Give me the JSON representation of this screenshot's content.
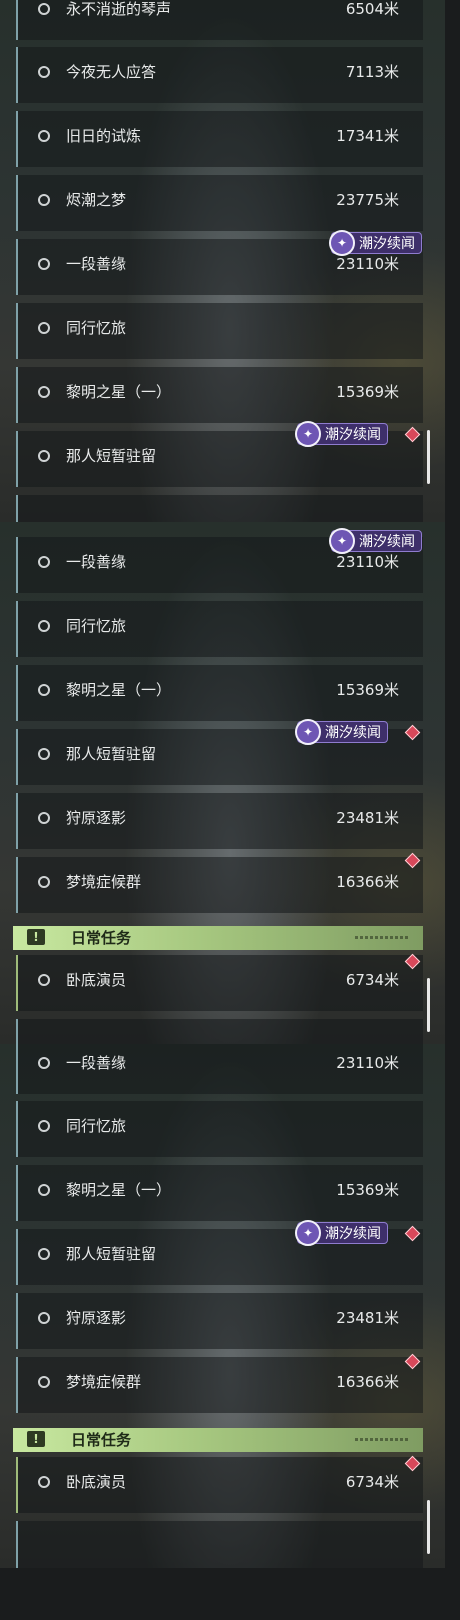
{
  "quests_top": [
    {
      "name": "永不消逝的琴声",
      "dist": "6504米"
    },
    {
      "name": "今夜无人应答",
      "dist": "7113米"
    },
    {
      "name": "旧日的试炼",
      "dist": "17341米"
    },
    {
      "name": "烬潮之梦",
      "dist": "23775米"
    },
    {
      "name": "一段善缘",
      "dist": "23110米"
    },
    {
      "name": "同行忆旅",
      "dist": ""
    },
    {
      "name": "黎明之星（一）",
      "dist": "15369米"
    },
    {
      "name": "那人短暂驻留",
      "dist": ""
    }
  ],
  "quests_mid": [
    {
      "name": "一段善缘",
      "dist": "23110米"
    },
    {
      "name": "同行忆旅",
      "dist": ""
    },
    {
      "name": "黎明之星（一）",
      "dist": "15369米"
    },
    {
      "name": "那人短暂驻留",
      "dist": ""
    },
    {
      "name": "狩原逐影",
      "dist": "23481米"
    },
    {
      "name": "梦境症候群",
      "dist": "16366米"
    }
  ],
  "quests_bottom": [
    {
      "name": "一段善缘",
      "dist": "23110米"
    },
    {
      "name": "同行忆旅",
      "dist": ""
    },
    {
      "name": "黎明之星（一）",
      "dist": "15369米"
    },
    {
      "name": "那人短暂驻留",
      "dist": ""
    },
    {
      "name": "狩原逐影",
      "dist": "23481米"
    },
    {
      "name": "梦境症候群",
      "dist": "16366米"
    }
  ],
  "tide_tag": "潮汐续闻",
  "daily": {
    "header": "日常任务",
    "icon_glyph": "!",
    "quest": {
      "name": "卧底演员",
      "dist": "6734米"
    }
  },
  "colors": {
    "tag_bg": "#3e2f6a",
    "header_accent": "#a7c880",
    "marker": "#d8485a"
  }
}
